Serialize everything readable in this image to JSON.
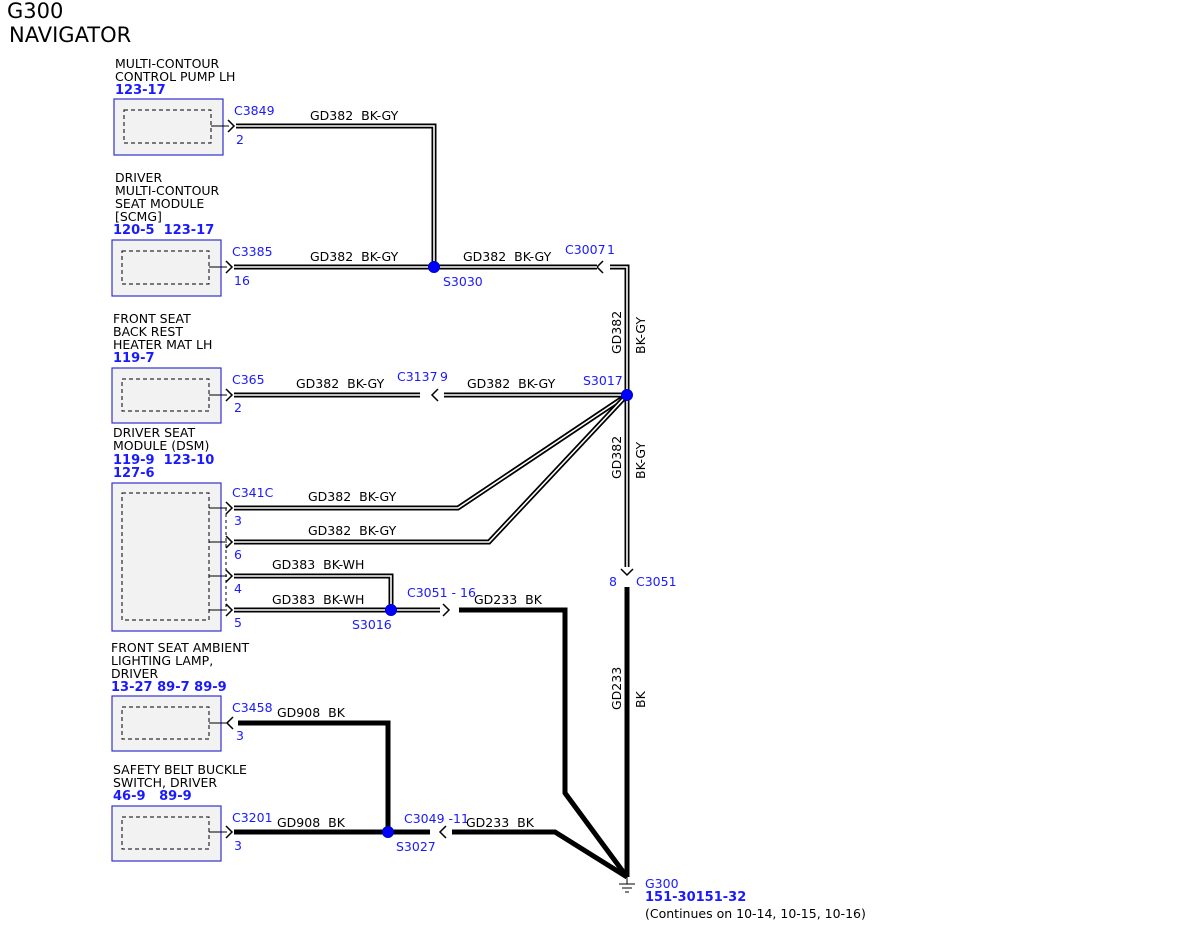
{
  "header": {
    "ground_id": "G300",
    "vehicle": "NAVIGATOR"
  },
  "components": [
    {
      "name_lines": [
        "MULTI-CONTOUR",
        "CONTROL PUMP LH"
      ],
      "refs": "123-17"
    },
    {
      "name_lines": [
        "DRIVER",
        "MULTI-CONTOUR",
        "SEAT MODULE",
        "[SCMG]"
      ],
      "refs": "120-5  123-17"
    },
    {
      "name_lines": [
        "FRONT SEAT",
        "BACK REST",
        "HEATER MAT LH"
      ],
      "refs": "119-7"
    },
    {
      "name_lines": [
        "DRIVER SEAT",
        "MODULE (DSM)"
      ],
      "refs": "119-9  123-10",
      "refs2": "127-6"
    },
    {
      "name_lines": [
        "FRONT SEAT AMBIENT",
        "LIGHTING LAMP,",
        "DRIVER"
      ],
      "refs": "13-27 89-7 89-9"
    },
    {
      "name_lines": [
        "SAFETY BELT BUCKLE",
        "SWITCH, DRIVER"
      ],
      "refs": "46-9   89-9"
    }
  ],
  "connectors": {
    "c3849": {
      "id": "C3849",
      "pin": "2"
    },
    "c3385": {
      "id": "C3385",
      "pin": "16"
    },
    "c365": {
      "id": "C365",
      "pin": "2"
    },
    "c341c": {
      "id": "C341C",
      "pins": [
        "3",
        "6",
        "4",
        "5"
      ]
    },
    "c3458": {
      "id": "C3458",
      "pin": "3"
    },
    "c3201": {
      "id": "C3201",
      "pin": "3"
    },
    "c3007": {
      "label": "C3007",
      "pin": "1"
    },
    "c3137": {
      "label": "C3137",
      "pin": "9"
    },
    "c3051_inline": {
      "label": "C3051 - 16"
    },
    "c3051": {
      "id": "C3051",
      "pin": "8"
    },
    "c3049": {
      "label": "C3049 -11"
    }
  },
  "splices": {
    "s3030": "S3030",
    "s3017": "S3017",
    "s3016": "S3016",
    "s3027": "S3027"
  },
  "wires": {
    "gd382_bkgy": "GD382  BK-GY",
    "gd382": "GD382",
    "bkgy": "BK-GY",
    "gd383_bkwh": "GD383  BK-WH",
    "gd233_bk": "GD233  BK",
    "gd233": "GD233",
    "bk": "BK",
    "gd908_bk": "GD908  BK"
  },
  "ground": {
    "id": "G300",
    "refs": "151-30151-32",
    "note": "(Continues on 10-14, 10-15, 10-16)"
  },
  "colors": {
    "connector_blue": "#3333cc",
    "splice_blue": "#0000ff",
    "ref_blue": "#1a1aff"
  }
}
